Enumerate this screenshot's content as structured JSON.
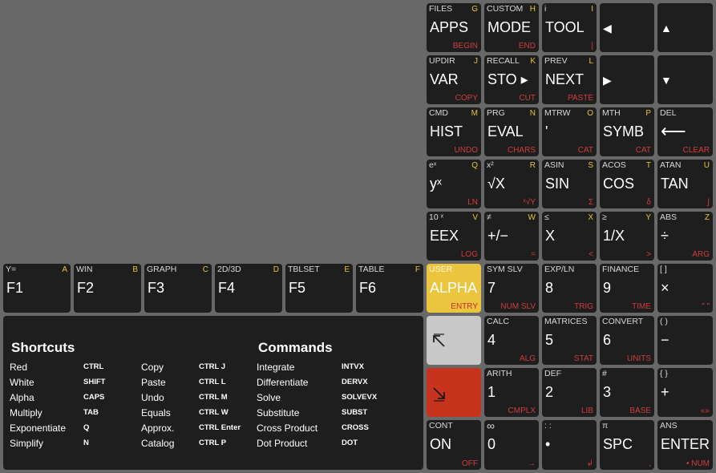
{
  "keys": {
    "apps": {
      "shift": "FILES",
      "alpha": "G",
      "main": "APPS",
      "right": "BEGIN"
    },
    "mode": {
      "shift": "CUSTOM",
      "alpha": "H",
      "main": "MODE",
      "right": "END"
    },
    "tool": {
      "shift": "i",
      "alpha": "I",
      "main": "TOOL",
      "right": "|"
    },
    "left": {
      "main": "◀"
    },
    "up": {
      "main": "▲"
    },
    "var": {
      "shift": "UPDIR",
      "alpha": "J",
      "main": "VAR",
      "right": "COPY"
    },
    "sto": {
      "shift": "RECALL",
      "alpha": "K",
      "main": "STO ▸",
      "right": "CUT"
    },
    "next": {
      "shift": "PREV",
      "alpha": "L",
      "main": "NEXT",
      "right": "PASTE"
    },
    "right": {
      "main": "▶"
    },
    "down": {
      "main": "▼"
    },
    "hist": {
      "shift": "CMD",
      "alpha": "M",
      "main": "HIST",
      "right": "UNDO"
    },
    "eval": {
      "shift": "PRG",
      "alpha": "N",
      "main": "EVAL",
      "right": "CHARS"
    },
    "quote": {
      "shift": "MTRW",
      "alpha": "O",
      "main": "'",
      "right": "CAT"
    },
    "symb": {
      "shift": "MTH",
      "alpha": "P",
      "main": "SYMB",
      "right": "CAT"
    },
    "bksp": {
      "shift": "DEL",
      "alpha": "",
      "main": "⟵",
      "right": "CLEAR"
    },
    "yx": {
      "shift": "eˣ",
      "alpha": "Q",
      "main": "yˣ",
      "right": "LN"
    },
    "sqrt": {
      "shift": "x²",
      "alpha": "R",
      "main": "√X",
      "right": "ˣ√Y"
    },
    "sin": {
      "shift": "ASIN",
      "alpha": "S",
      "main": "SIN",
      "right": "Σ"
    },
    "cos": {
      "shift": "ACOS",
      "alpha": "T",
      "main": "COS",
      "right": "δ"
    },
    "tan": {
      "shift": "ATAN",
      "alpha": "U",
      "main": "TAN",
      "right": "∫"
    },
    "eex": {
      "shift": "10 ˣ",
      "alpha": "V",
      "main": "EEX",
      "right": "LOG"
    },
    "neg": {
      "shift": "≠",
      "alpha": "W",
      "main": "+/−",
      "right": "="
    },
    "x": {
      "shift": "≤",
      "alpha": "X",
      "main": "X",
      "right": "<"
    },
    "inv": {
      "shift": "≥",
      "alpha": "Y",
      "main": "1/X",
      "right": ">"
    },
    "div": {
      "shift": "ABS",
      "alpha": "Z",
      "main": "÷",
      "right": "ARG"
    },
    "f1": {
      "shift": "Y=",
      "alpha": "A",
      "main": "F1"
    },
    "f2": {
      "shift": "WIN",
      "alpha": "B",
      "main": "F2"
    },
    "f3": {
      "shift": "GRAPH",
      "alpha": "C",
      "main": "F3"
    },
    "f4": {
      "shift": "2D/3D",
      "alpha": "D",
      "main": "F4"
    },
    "f5": {
      "shift": "TBLSET",
      "alpha": "E",
      "main": "F5"
    },
    "f6": {
      "shift": "TABLE",
      "alpha": "F",
      "main": "F6"
    },
    "alpha": {
      "shift": "USER",
      "main": "ALPHA",
      "right": "ENTRY"
    },
    "k7": {
      "shift": "SYM SLV",
      "main": "7",
      "right": "NUM SLV"
    },
    "k8": {
      "shift": "EXP/LN",
      "main": "8",
      "right": "TRIG"
    },
    "k9": {
      "shift": "FINANCE",
      "main": "9",
      "right": "TIME"
    },
    "mul": {
      "shift": "[ ]",
      "main": "×",
      "right": "\" \""
    },
    "k4": {
      "shift": "CALC",
      "main": "4",
      "right": "ALG"
    },
    "k5": {
      "shift": "MATRICES",
      "main": "5",
      "right": "STAT"
    },
    "k6": {
      "shift": "CONVERT",
      "main": "6",
      "right": "UNITS"
    },
    "sub": {
      "shift": "( )",
      "main": "−"
    },
    "k1": {
      "shift": "ARITH",
      "main": "1",
      "right": "CMPLX"
    },
    "k2": {
      "shift": "DEF",
      "main": "2",
      "right": "LIB"
    },
    "k3": {
      "shift": "#",
      "main": "3",
      "right": "BASE"
    },
    "add": {
      "shift": "{ }",
      "main": "+",
      "right": "«»"
    },
    "on": {
      "shift": "CONT",
      "main": "ON",
      "right": "OFF"
    },
    "k0": {
      "shift": "∞",
      "main": "0",
      "right": "→"
    },
    "dot": {
      "shift": ": :",
      "main": "•",
      "right": "↲"
    },
    "spc": {
      "shift": "π",
      "main": "SPC",
      "right": ","
    },
    "enter": {
      "shift": "ANS",
      "main": "ENTER",
      "right": "• NUM"
    }
  },
  "shortcuts": {
    "title": "Shortcuts",
    "rows": [
      {
        "label": "Red",
        "key": "CTRL"
      },
      {
        "label": "White",
        "key": "SHIFT"
      },
      {
        "label": "Alpha",
        "key": "CAPS"
      },
      {
        "label": "Multiply",
        "key": "TAB"
      },
      {
        "label": "Exponentiate",
        "key": "Q"
      },
      {
        "label": "Simplify",
        "key": "N"
      }
    ],
    "rows2": [
      {
        "label": "Copy",
        "key": "CTRL J"
      },
      {
        "label": "Paste",
        "key": "CTRL L"
      },
      {
        "label": "Undo",
        "key": "CTRL M"
      },
      {
        "label": "Equals",
        "key": "CTRL W"
      },
      {
        "label": "Approx.",
        "key": "CTRL Enter"
      },
      {
        "label": "Catalog",
        "key": "CTRL P"
      }
    ]
  },
  "commands": {
    "title": "Commands",
    "rows": [
      {
        "label": "Integrate",
        "key": "INTVX"
      },
      {
        "label": "Differentiate",
        "key": "DERVX"
      },
      {
        "label": "Solve",
        "key": "SOLVEVX"
      },
      {
        "label": "Substitute",
        "key": "SUBST"
      },
      {
        "label": "Cross Product",
        "key": "CROSS"
      },
      {
        "label": "Dot Product",
        "key": "DOT"
      }
    ]
  },
  "colors": {
    "background": "#686868",
    "key": "#1e1e1e",
    "alpha_key": "#ebc53d",
    "shift_left": "#c8c8c8",
    "shift_right": "#c8331e",
    "alpha_label": "#e5c23e",
    "red_label": "#d03c3c"
  },
  "icons": {
    "shift_left": "arrow-up-left-icon",
    "shift_right": "arrow-down-right-icon"
  }
}
